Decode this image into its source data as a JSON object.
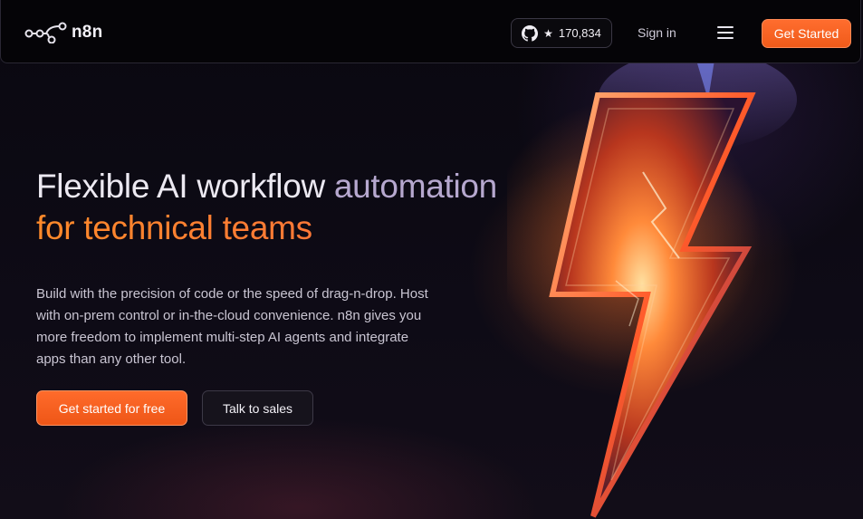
{
  "header": {
    "logo_text": "n8n",
    "github": {
      "icon": "github-icon",
      "star_glyph": "★",
      "stars": "170,834"
    },
    "signin_label": "Sign in",
    "menu_icon": "hamburger-menu-icon",
    "cta_label": "Get Started"
  },
  "hero": {
    "title_part1": "Flexible AI workflow ",
    "title_accent": "automation",
    "title_line2": "for technical teams",
    "description": "Build with the precision of code or the speed of drag-n-drop. Host with on-prem control or in-the-cloud convenience. n8n gives you more freedom to implement multi-step AI agents and integrate apps than any other tool.",
    "primary_button": "Get started for free",
    "secondary_button": "Talk to sales"
  },
  "colors": {
    "accent_orange": "#ff6d2e",
    "title_accent": "#b6a8cf",
    "background": "#0b0913"
  },
  "illustration": {
    "icon": "lightning-bolt-icon"
  }
}
